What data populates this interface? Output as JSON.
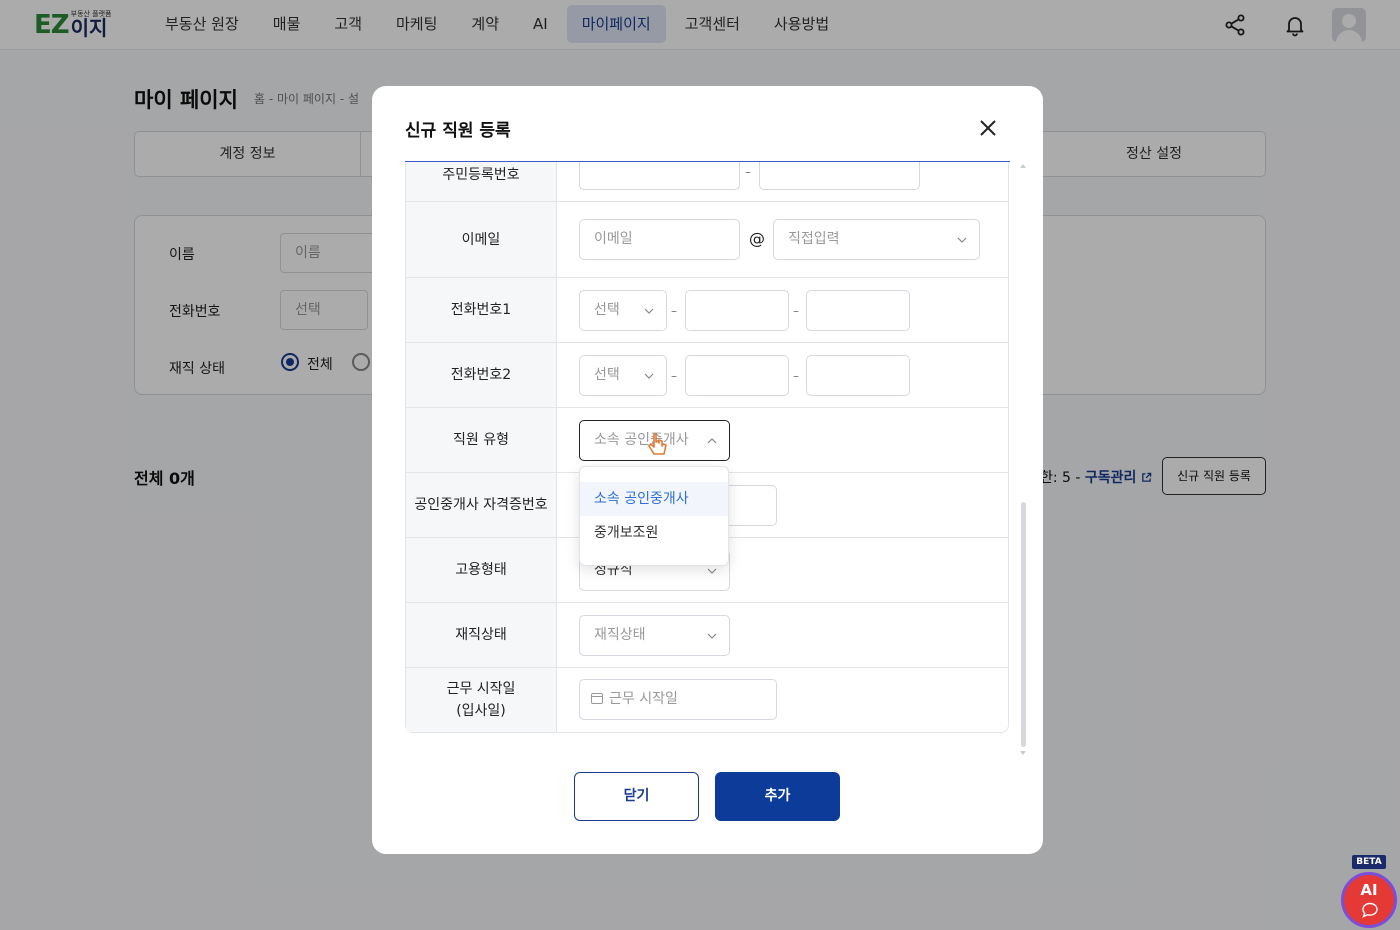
{
  "logo": {
    "brand": "EZ",
    "sub": "부동산 플랫폼",
    "name": "이지"
  },
  "nav": [
    {
      "label": "부동산 원장",
      "active": false
    },
    {
      "label": "매물",
      "active": false
    },
    {
      "label": "고객",
      "active": false
    },
    {
      "label": "마케팅",
      "active": false
    },
    {
      "label": "계약",
      "active": false
    },
    {
      "label": "AI",
      "active": false
    },
    {
      "label": "마이페이지",
      "active": true
    },
    {
      "label": "고객센터",
      "active": false
    },
    {
      "label": "사용방법",
      "active": false
    }
  ],
  "page": {
    "title": "마이 페이지",
    "breadcrumb": "홈 - 마이 페이지 - 설",
    "tabs": [
      "계정 정보",
      "정산 설정"
    ],
    "filters": {
      "name_label": "이름",
      "name_placeholder": "이름",
      "phone_label": "전화번호",
      "phone_select": "선택",
      "status_label": "재직 상태",
      "status_option_all": "전체"
    },
    "total": "전체 0개",
    "limit_text": "한: 5 - ",
    "subscription_link": "구독관리",
    "register_button": "신규 직원 등록"
  },
  "modal": {
    "title": "신규 직원 등록",
    "fields": {
      "rrn_label": "주민등록번호",
      "email_label": "이메일",
      "email_placeholder": "이메일",
      "email_at": "@",
      "email_domain": "직접입력",
      "phone1_label": "전화번호1",
      "phone1_select": "선택",
      "phone2_label": "전화번호2",
      "phone2_select": "선택",
      "dash": "–",
      "type_label": "직원 유형",
      "type_value": "소속 공인중개사",
      "license_label": "공인중개사 자격증번호",
      "employment_label": "고용형태",
      "employment_value": "정규직",
      "status_label": "재직상태",
      "status_placeholder": "재직상태",
      "start_label_line1": "근무 시작일",
      "start_label_line2": "(입사일)",
      "start_placeholder": "근무 시작일"
    },
    "dropdown_options": [
      "소속 공인중개사",
      "중개보조원"
    ],
    "close_button": "닫기",
    "add_button": "추가"
  },
  "ai_fab": {
    "label": "AI",
    "badge": "BETA"
  },
  "colors": {
    "primary": "#0d3b99",
    "accent": "#2f6fd6",
    "logo_green": "#2c8a3a",
    "fab_red": "#e53935"
  }
}
